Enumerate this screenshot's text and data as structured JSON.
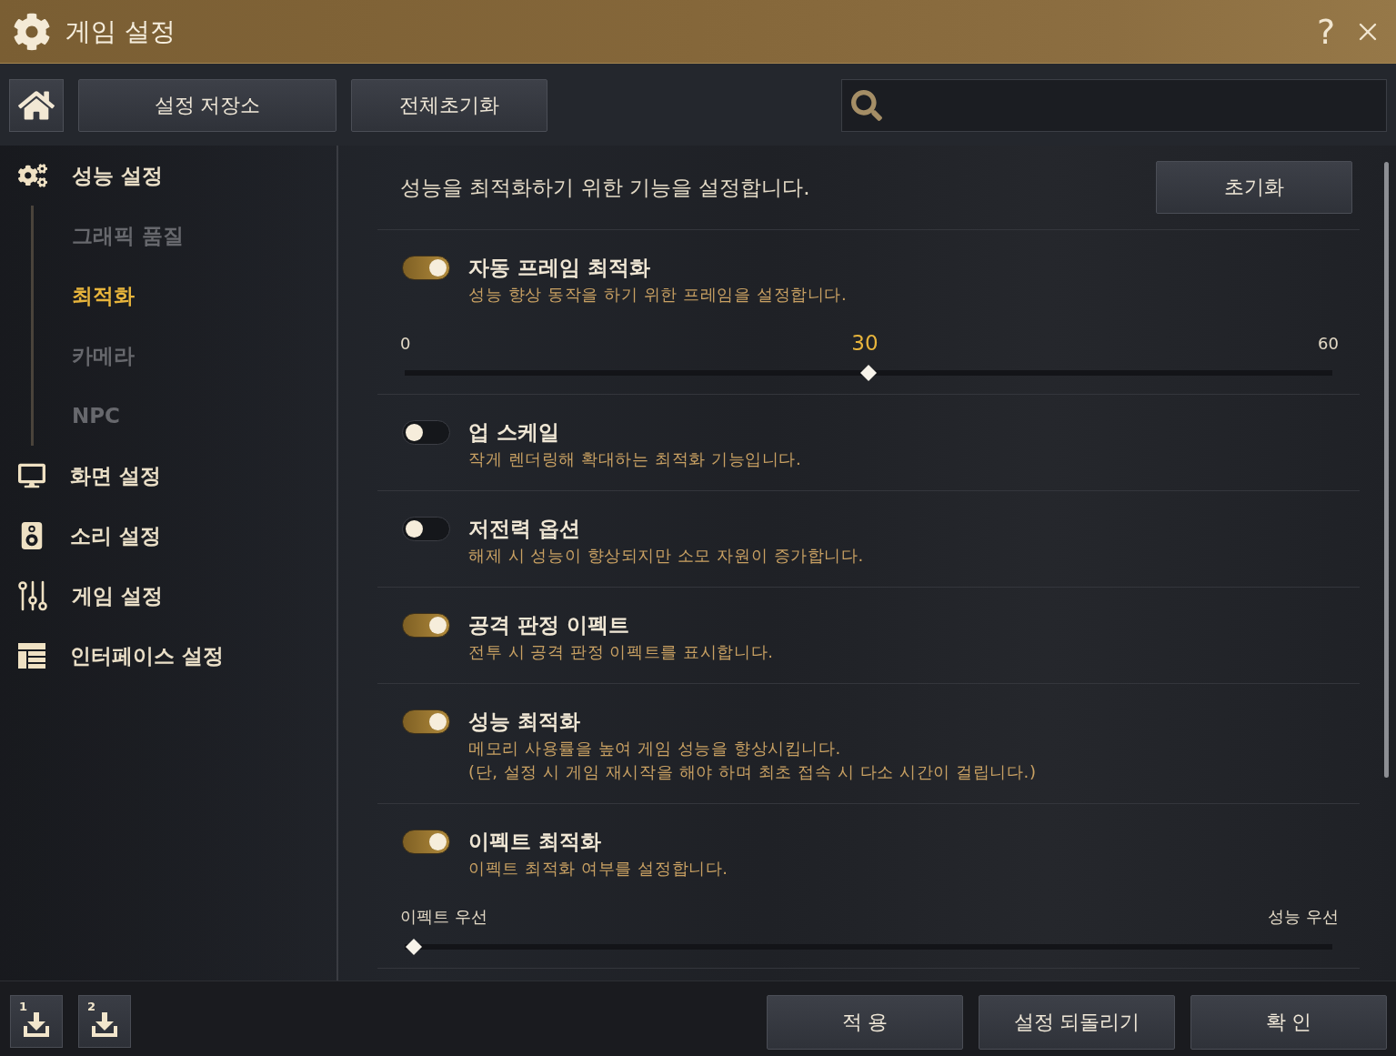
{
  "window": {
    "title": "게임 설정",
    "help": "?"
  },
  "toolbar": {
    "buttons": [
      "설정 저장소",
      "전체초기화"
    ]
  },
  "sidebar": {
    "items": [
      {
        "label": "성능 설정",
        "selected": false,
        "children": [
          {
            "label": "그래픽 품질",
            "selected": false
          },
          {
            "label": "최적화",
            "selected": true
          },
          {
            "label": "카메라",
            "selected": false
          },
          {
            "label": "NPC",
            "selected": false
          }
        ]
      },
      {
        "label": "화면 설정",
        "selected": false
      },
      {
        "label": "소리 설정",
        "selected": false
      },
      {
        "label": "게임 설정",
        "selected": false
      },
      {
        "label": "인터페이스 설정",
        "selected": false
      }
    ]
  },
  "panel": {
    "description": "성능을 최적화하기 위한 기능을 설정합니다.",
    "reset_button": "초기화",
    "options": [
      {
        "title": "자동 프레임 최적화",
        "description": [
          "성능 향상 동작을 하기 위한 프레임을 설정합니다."
        ],
        "on": true,
        "slider": {
          "min_label": "0",
          "value_label": "30",
          "max_label": "60",
          "level": 0.5
        }
      },
      {
        "title": "업 스케일",
        "description": [
          "작게 렌더링해 확대하는 최적화 기능입니다."
        ],
        "on": false
      },
      {
        "title": "저전력 옵션",
        "description": [
          "해제 시 성능이 향상되지만 소모 자원이 증가합니다."
        ],
        "on": false
      },
      {
        "title": "공격 판정 이펙트",
        "description": [
          "전투 시 공격 판정 이펙트를 표시합니다."
        ],
        "on": true
      },
      {
        "title": "성능 최적화",
        "description": [
          "메모리 사용률을 높여 게임 성능을 향상시킵니다.",
          "(단, 설정 시 게임 재시작을 해야 하며 최초 접속 시 다소 시간이 걸립니다.)"
        ],
        "on": true
      },
      {
        "title": "이펙트 최적화",
        "description": [
          "이펙트 최적화 여부를 설정합니다."
        ],
        "on": true,
        "slider": {
          "min_label": "이펙트 우선",
          "max_label": "성능 우선",
          "level": 0
        }
      }
    ]
  },
  "footer": {
    "slot_buttons": [
      "1",
      "2"
    ],
    "buttons": [
      "적 용",
      "설정 되돌리기",
      "확 인"
    ]
  }
}
